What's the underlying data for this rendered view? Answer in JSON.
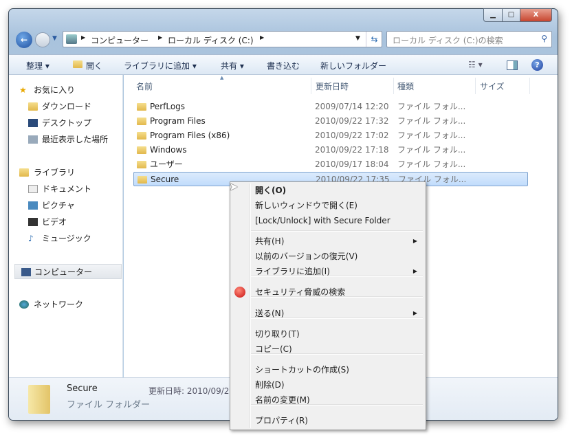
{
  "window": {
    "minimize": "▁",
    "maximize": "□",
    "close": "X"
  },
  "address": {
    "crumbs": [
      "コンピューター",
      "ローカル ディスク (C:)"
    ]
  },
  "search": {
    "placeholder": "ローカル ディスク (C:)の検索"
  },
  "toolbar": {
    "organize": "整理",
    "open": "開く",
    "add_library": "ライブラリに追加",
    "share": "共有",
    "burn": "書き込む",
    "new_folder": "新しいフォルダー"
  },
  "sidebar": {
    "items": [
      "お気に入り",
      "ダウンロード",
      "デスクトップ",
      "最近表示した場所",
      "ライブラリ",
      "ドキュメント",
      "ピクチャ",
      "ビデオ",
      "ミュージック",
      "コンピューター",
      "ネットワーク"
    ]
  },
  "columns": [
    "名前",
    "更新日時",
    "種類",
    "サイズ"
  ],
  "files": [
    {
      "name": "PerfLogs",
      "date": "2009/07/14 12:20",
      "type": "ファイル フォル..."
    },
    {
      "name": "Program Files",
      "date": "2010/09/22 17:32",
      "type": "ファイル フォル..."
    },
    {
      "name": "Program Files (x86)",
      "date": "2010/09/22 17:02",
      "type": "ファイル フォル..."
    },
    {
      "name": "Windows",
      "date": "2010/09/22 17:18",
      "type": "ファイル フォル..."
    },
    {
      "name": "ユーザー",
      "date": "2010/09/17 18:04",
      "type": "ファイル フォル..."
    },
    {
      "name": "Secure",
      "date": "2010/09/22 17:35",
      "type": "ファイル フォル..."
    }
  ],
  "status": {
    "name": "Secure",
    "type": "ファイル フォルダー",
    "modified": "更新日時: 2010/09/22"
  },
  "menu": {
    "items": [
      "開く(O)",
      "新しいウィンドウで開く(E)",
      "[Lock/Unlock] with Secure Folder",
      "共有(H)",
      "以前のバージョンの復元(V)",
      "ライブラリに追加(I)",
      "セキュリティ脅威の検索",
      "送る(N)",
      "切り取り(T)",
      "コピー(C)",
      "ショートカットの作成(S)",
      "削除(D)",
      "名前の変更(M)",
      "プロパティ(R)"
    ]
  }
}
